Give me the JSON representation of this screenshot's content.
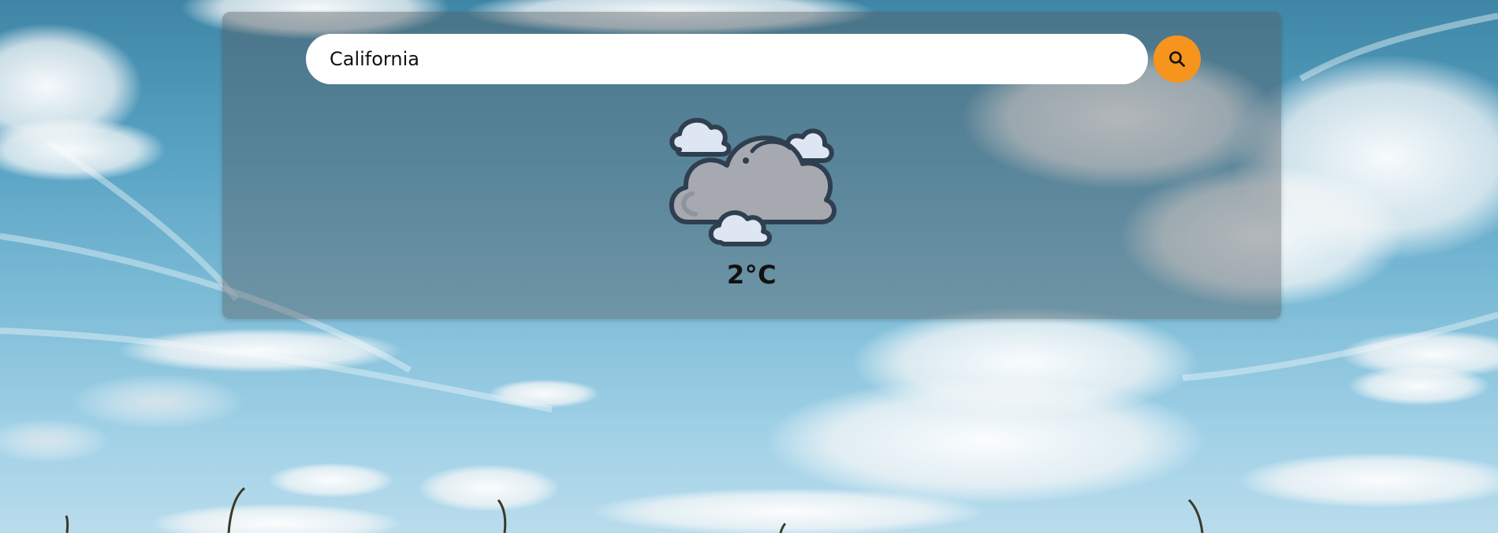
{
  "search": {
    "value": "California",
    "button_icon": "search-icon"
  },
  "weather": {
    "icon": "partly-cloudy-icon",
    "temperature": "2°C"
  },
  "colors": {
    "accent": "#f7941d",
    "card_overlay": "#555a5f",
    "text": "#111111"
  }
}
